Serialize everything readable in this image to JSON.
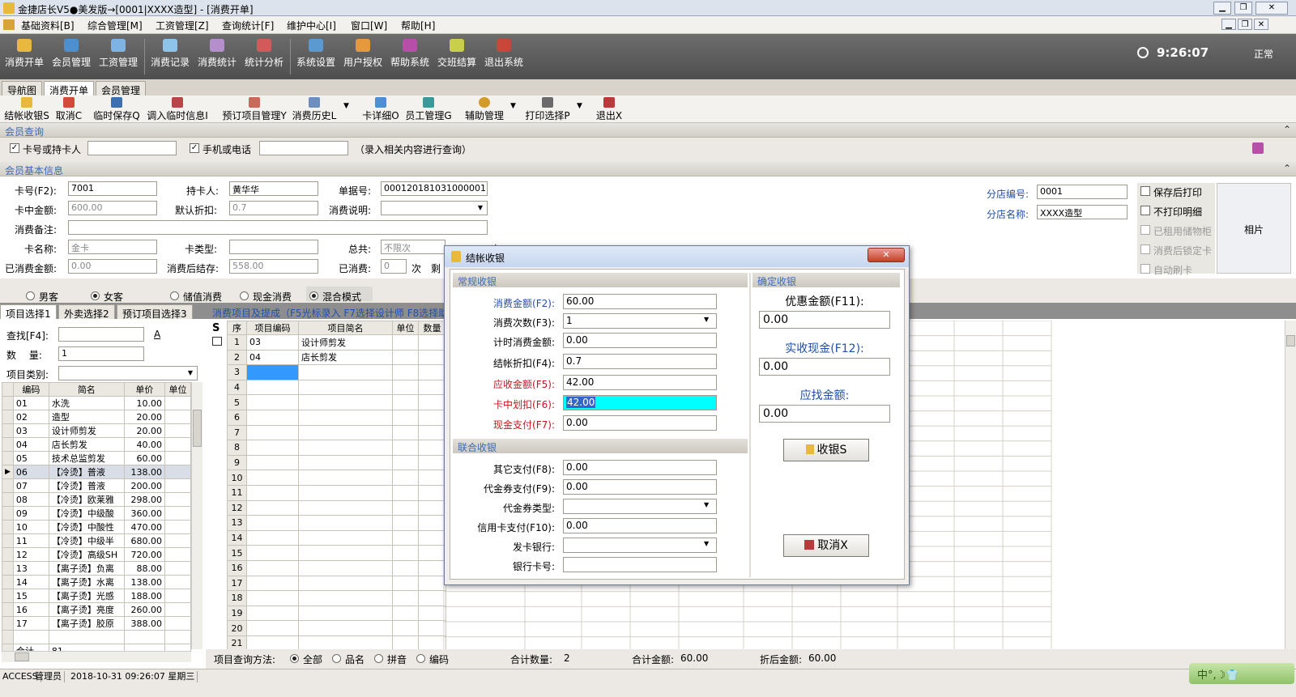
{
  "window": {
    "title": "金捷店长V5●美发版→[0001|XXXX造型] - [消费开单]"
  },
  "menu": [
    "基础资料[B]",
    "综合管理[M]",
    "工资管理[Z]",
    "查询统计[F]",
    "维护中心[I]",
    "窗口[W]",
    "帮助[H]"
  ],
  "bigbar": {
    "buttons": [
      "消费开单",
      "会员管理",
      "工资管理",
      "消费记录",
      "消费统计",
      "统计分析",
      "系统设置",
      "用户授权",
      "帮助系统",
      "交班结算",
      "退出系统"
    ],
    "clock": "9:26:07",
    "status": "正常"
  },
  "tabs": [
    "导航图",
    "消费开单",
    "会员管理"
  ],
  "smallbar": [
    "结帐收银S",
    "取消C",
    "临时保存Q",
    "调入临时信息I",
    "预订项目管理Y",
    "消费历史L",
    "卡详细O",
    "员工管理G",
    "辅助管理",
    "打印选择P",
    "退出X"
  ],
  "member_query": {
    "header": "会员查询",
    "card_label": "卡号或持卡人",
    "phone_label": "手机或电话",
    "hint": "（录入相关内容进行查询）"
  },
  "member_info": {
    "header": "会员基本信息",
    "card_no_label": "卡号(F2):",
    "card_no": "7001",
    "holder_label": "持卡人:",
    "holder": "黄华华",
    "bill_label": "单据号:",
    "bill": "0001201810310000011",
    "balance_label": "卡中金额:",
    "balance": "600.00",
    "discount_label": "默认折扣:",
    "discount": "0.7",
    "desc_label": "消费说明:",
    "remark_label": "消费备注:",
    "card_name_label": "卡名称:",
    "card_name": "金卡",
    "card_type_label": "卡类型:",
    "total_label": "总共:",
    "total": "不限次",
    "ci": "次",
    "spent_label": "已消费金额:",
    "spent": "0.00",
    "after_label": "消费后结存:",
    "after": "558.00",
    "used_label": "已消费:",
    "used": "0",
    "used_unit": "次",
    "remain": "剩",
    "branch_no_label": "分店编号:",
    "branch_no": "0001",
    "branch_name_label": "分店名称:",
    "branch_name": "XXXX造型",
    "opts": [
      "保存后打印",
      "不打印明细",
      "已租用储物柜",
      "消费后锁定卡",
      "自动刷卡"
    ],
    "photo": "相片"
  },
  "gender": {
    "male": "男客",
    "female": "女客",
    "modes": [
      "储值消费",
      "现金消费",
      "混合模式"
    ]
  },
  "lefttabs": [
    "项目选择1",
    "外卖选择2",
    "预订项目选择3"
  ],
  "righthint": "消费项目及提成（F5光标录入 F7选择设计师  F8选择助",
  "left": {
    "find_label": "查找[F4]:",
    "qty_label": "数　 量:",
    "qty": "1",
    "cat_label": "项目类别:",
    "A": "A",
    "cols": [
      "编码",
      "简名",
      "单价",
      "单位"
    ],
    "rows": [
      [
        "01",
        "水洗",
        "10.00"
      ],
      [
        "02",
        "造型",
        "20.00"
      ],
      [
        "03",
        "设计师剪发",
        "20.00"
      ],
      [
        "04",
        "店长剪发",
        "40.00"
      ],
      [
        "05",
        "技术总监剪发",
        "60.00"
      ],
      [
        "06",
        "【冷烫】普液",
        "138.00"
      ],
      [
        "07",
        "【冷烫】普液",
        "200.00"
      ],
      [
        "08",
        "【冷烫】欧莱雅",
        "298.00"
      ],
      [
        "09",
        "【冷烫】中级酸",
        "360.00"
      ],
      [
        "10",
        "【冷烫】中酸性",
        "470.00"
      ],
      [
        "11",
        "【冷烫】中级半",
        "680.00"
      ],
      [
        "12",
        "【冷烫】高级SH",
        "720.00"
      ],
      [
        "13",
        "【离子烫】负离",
        "88.00"
      ],
      [
        "14",
        "【离子烫】水离",
        "138.00"
      ],
      [
        "15",
        "【离子烫】光感",
        "188.00"
      ],
      [
        "16",
        "【离子烫】亮度",
        "260.00"
      ],
      [
        "17",
        "【离子烫】胶原",
        "388.00"
      ]
    ],
    "total_label": "合计",
    "total": "81"
  },
  "items": {
    "cols": [
      "序",
      "项目编码",
      "项目简名",
      "单位",
      "数量"
    ],
    "rows": [
      [
        "1",
        "03",
        "设计师剪发"
      ],
      [
        "2",
        "04",
        "店长剪发"
      ]
    ]
  },
  "bottom": {
    "method_label": "项目查询方法:",
    "methods": [
      "全部",
      "品名",
      "拼音",
      "编码"
    ],
    "count_label": "合计数量:",
    "count": "2",
    "sum_label": "合计金额:",
    "sum": "60.00",
    "after_label": "折后金额:",
    "after": "60.00"
  },
  "dialog": {
    "title": "结帐收银",
    "normal": "常规收银",
    "confirm": "确定收银",
    "joint": "联合收银",
    "f2_label": "消费金额(F2):",
    "f2": "60.00",
    "f3_label": "消费次数(F3):",
    "f3": "1",
    "timer_label": "计时消费金额:",
    "timer": "0.00",
    "f4_label": "结帐折扣(F4):",
    "f4": "0.7",
    "f5_label": "应收金额(F5):",
    "f5": "42.00",
    "f6_label": "卡中划扣(F6):",
    "f6": "42.00",
    "f7_label": "现金支付(F7):",
    "f7": "0.00",
    "f8_label": "其它支付(F8):",
    "f8": "0.00",
    "f9_label": "代金券支付(F9):",
    "f9": "0.00",
    "vtype_label": "代金券类型:",
    "f10_label": "信用卡支付(F10):",
    "f10": "0.00",
    "bank_label": "发卡银行:",
    "bankno_label": "银行卡号:",
    "f11_label": "优惠金额(F11):",
    "f11": "0.00",
    "f12_label": "实收现金(F12):",
    "f12": "0.00",
    "change_label": "应找金额:",
    "change": "0.00",
    "ok": "收银S",
    "cancel": "取消X"
  },
  "status": [
    "ACCESS",
    "管理员",
    "2018-10-31  09:26:07  星期三"
  ],
  "ime": "中°,☽👕"
}
